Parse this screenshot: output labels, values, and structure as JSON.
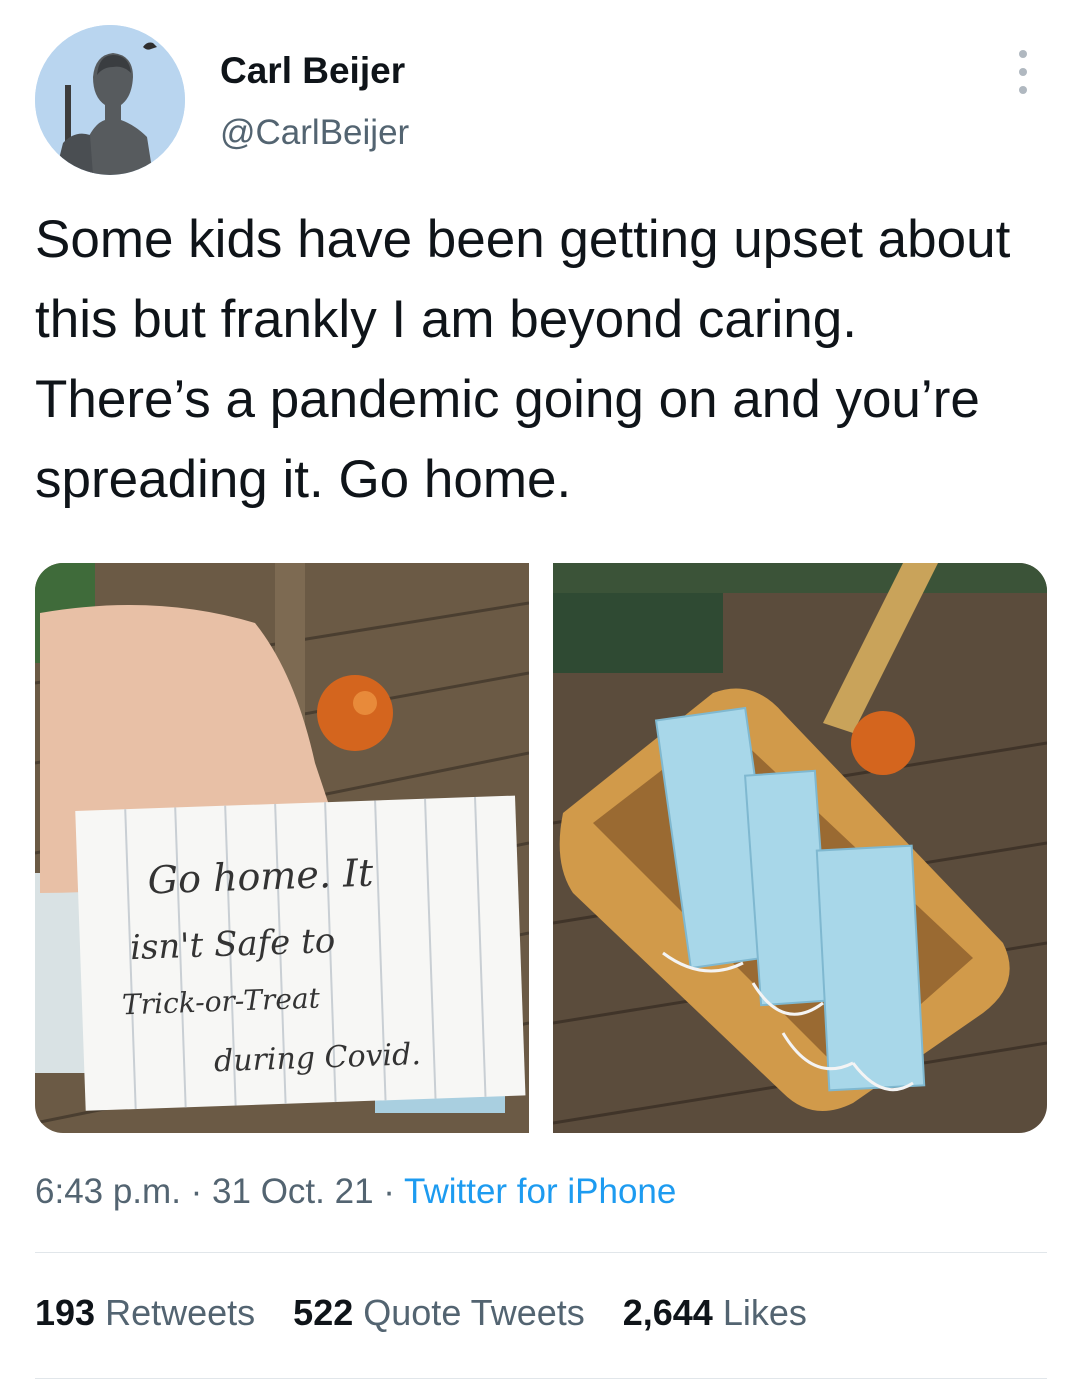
{
  "user": {
    "name": "Carl Beijer",
    "handle": "@CarlBeijer"
  },
  "tweet": {
    "text": "Some kids have been getting upset about this but frankly I am beyond caring. There’s a pandemic going on and you’re spreading it. Go home."
  },
  "media": {
    "note_lines": [
      "Go home. It",
      "isn't Safe to",
      "Trick-or-Treat",
      "during Covid."
    ]
  },
  "meta": {
    "time": "6:43 p.m.",
    "separator": "·",
    "date": "31 Oct. 21",
    "source": "Twitter for iPhone"
  },
  "stats": {
    "retweets_count": "193",
    "retweets_label": "Retweets",
    "quotes_count": "522",
    "quotes_label": "Quote Tweets",
    "likes_count": "2,644",
    "likes_label": "Likes"
  },
  "icons": {
    "more": "more-options-icon"
  },
  "colors": {
    "text_primary": "#0f1419",
    "text_secondary": "#536471",
    "link": "#1d9bf0",
    "divider": "#e1e6ea"
  }
}
